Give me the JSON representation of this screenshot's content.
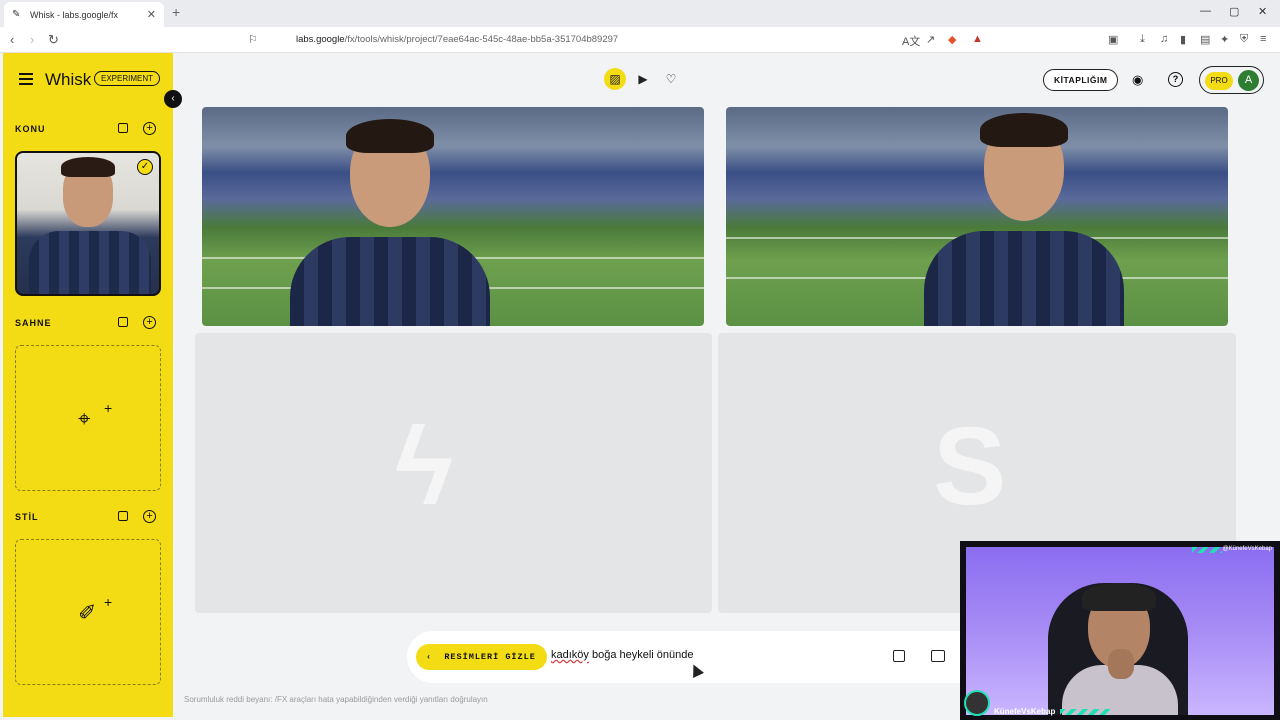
{
  "browser": {
    "tab_title": "Whisk - labs.google/fx",
    "tab_close": "✕",
    "new_tab": "+",
    "url_domain": "labs.google",
    "url_path": "/fx/tools/whisk/project/7eae64ac-545c-48ae-bb5a-351704b89297"
  },
  "sidebar": {
    "brand": "Whisk",
    "badge": "EXPERIMENT",
    "sections": {
      "subject": "KONU",
      "scene": "SAHNE",
      "style": "STİL"
    }
  },
  "header": {
    "library_label": "KİTAPLIĞIM",
    "pro_label": "PRO",
    "avatar_letter": "A"
  },
  "prompt": {
    "hide_images_label": "RESİMLERİ GİZLE",
    "text_squiggle": "kadıköy",
    "text_rest": " boğa heykeli önünde"
  },
  "footer": {
    "disclaimer": "Sorumluluk reddi beyanı: /FX araçları hata yapabildiğinden verdiği yanıtları doğrulayın"
  },
  "webcam": {
    "handle_top": "@KünefeVsKebap",
    "handle_bottom": "KünefeVsKebap"
  },
  "colors": {
    "accent": "#f4dc14",
    "avatar": "#2e7d32",
    "webcam_accent": "#22e0b5"
  }
}
